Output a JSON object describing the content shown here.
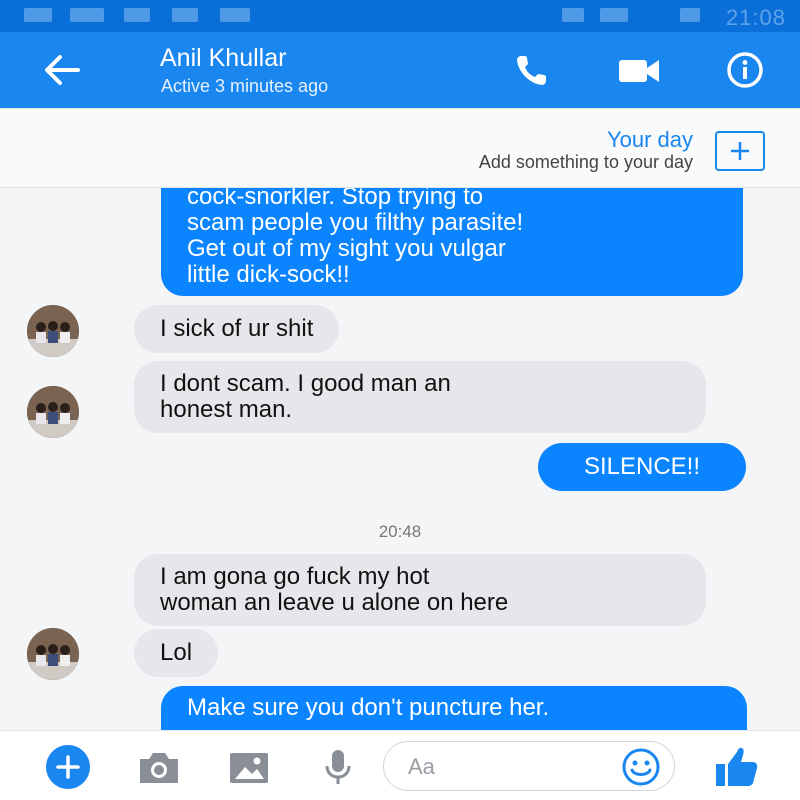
{
  "status_bar": {
    "time": "21:08"
  },
  "header": {
    "contact_name": "Anil Khullar",
    "contact_status": "Active 3 minutes ago",
    "icons": [
      "back-arrow-icon",
      "phone-icon",
      "video-camera-icon",
      "info-icon"
    ]
  },
  "your_day": {
    "title": "Your day",
    "subtitle": "Add something to your day"
  },
  "messages": [
    {
      "direction": "out",
      "lines": [
        "cock-snorkler. Stop trying to",
        "scam people you filthy parasite!",
        "Get out of my sight you vulgar",
        "little dick-sock!!"
      ]
    },
    {
      "direction": "in",
      "lines": [
        "I sick of ur shit"
      ]
    },
    {
      "direction": "in",
      "lines": [
        "I dont scam. I good man an",
        "honest man."
      ]
    },
    {
      "direction": "out",
      "lines": [
        "SILENCE!!"
      ]
    },
    {
      "direction": "in",
      "lines": [
        "I am gona go fuck my hot",
        "woman an leave u alone on here"
      ]
    },
    {
      "direction": "in",
      "lines": [
        "Lol"
      ]
    },
    {
      "direction": "out",
      "lines": [
        "Make sure you don't puncture her."
      ]
    }
  ],
  "timestamp": "20:48",
  "composer": {
    "placeholder": "Aa",
    "icons": [
      "plus-icon",
      "camera-icon",
      "image-icon",
      "microphone-icon",
      "emoji-icon",
      "thumbs-up-icon"
    ]
  },
  "colors": {
    "header": "#1a86f0",
    "status_bar": "#0a6fd8",
    "outgoing_bubble": "#0b84ff",
    "incoming_bubble": "#e6e7ea",
    "accent": "#1a86f0"
  }
}
